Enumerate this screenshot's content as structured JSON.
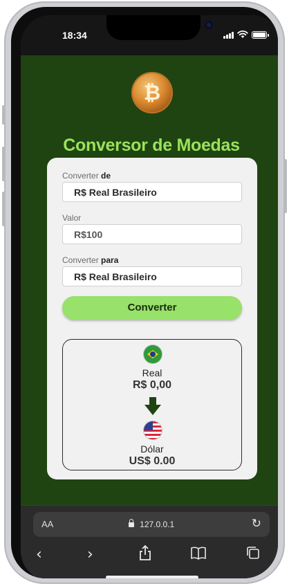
{
  "status_bar": {
    "time": "18:34"
  },
  "app": {
    "title": "Conversor de Moedas",
    "from": {
      "label_prefix": "Converter",
      "label_bold": "de",
      "value": "R$ Real Brasileiro"
    },
    "amount": {
      "label": "Valor",
      "value": "R$100"
    },
    "to": {
      "label_prefix": "Converter",
      "label_bold": "para",
      "value": "R$ Real Brasileiro"
    },
    "convert_button": "Converter",
    "result": {
      "from_name": "Real",
      "from_value": "R$ 0,00",
      "to_name": "Dólar",
      "to_value": "US$ 0.00"
    },
    "colors": {
      "background": "#1f4412",
      "accent": "#98e16a",
      "title": "#9be25a"
    }
  },
  "browser": {
    "aa": "AA",
    "url": "127.0.0.1"
  }
}
